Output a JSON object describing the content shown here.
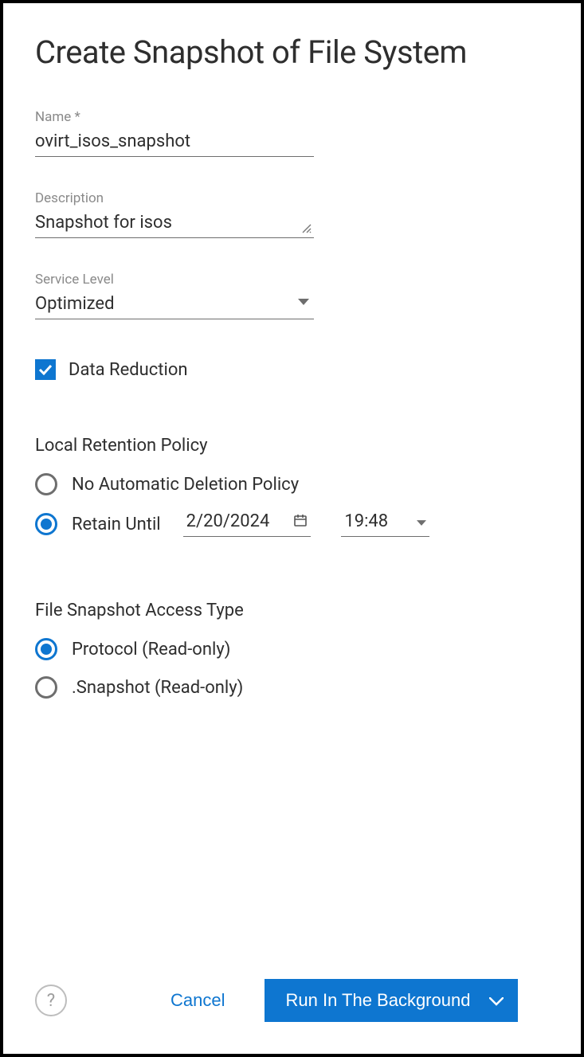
{
  "title": "Create Snapshot of File System",
  "fields": {
    "name": {
      "label": "Name *",
      "value": "ovirt_isos_snapshot"
    },
    "description": {
      "label": "Description",
      "value": "Snapshot for isos"
    },
    "service_level": {
      "label": "Service Level",
      "value": "Optimized"
    }
  },
  "data_reduction": {
    "label": "Data Reduction",
    "checked": true
  },
  "retention": {
    "header": "Local Retention Policy",
    "no_auto_label": "No Automatic Deletion Policy",
    "retain_until_label": "Retain Until",
    "date": "2/20/2024",
    "time": "19:48",
    "selected": "retain_until"
  },
  "access_type": {
    "header": "File Snapshot Access Type",
    "protocol_label": "Protocol (Read-only)",
    "snapshot_label": ".Snapshot (Read-only)",
    "selected": "protocol"
  },
  "footer": {
    "cancel": "Cancel",
    "primary": "Run In The Background"
  }
}
